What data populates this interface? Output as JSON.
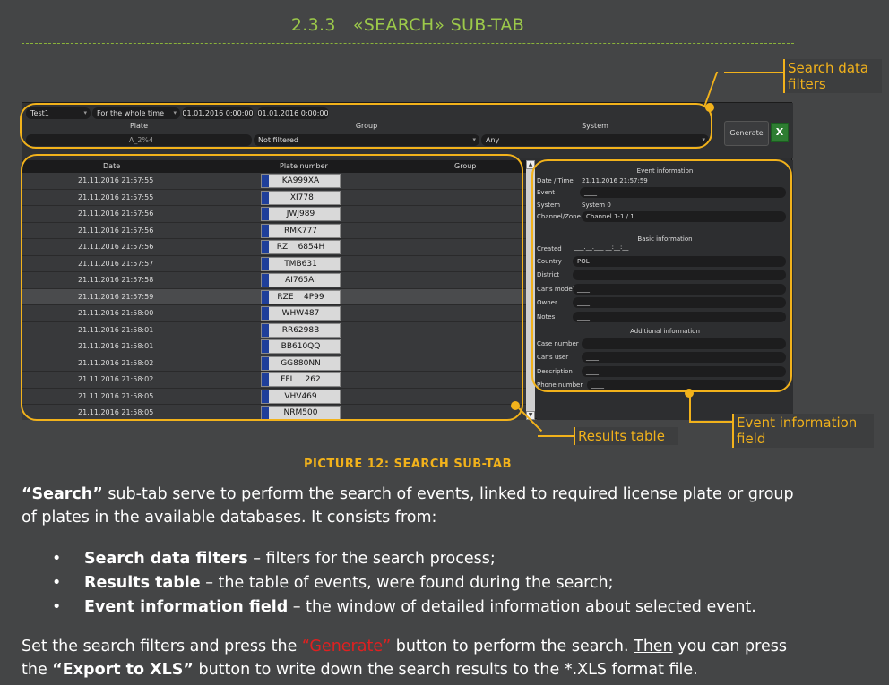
{
  "section": {
    "number": "2.3.3",
    "title": "«SEARCH» SUB-TAB"
  },
  "filters": {
    "source": "Test1",
    "period": "For the whole time",
    "date_from": "01.01.2016 0:00:00",
    "date_to": "01.01.2016 0:00:00",
    "plate_label": "Plate",
    "plate_value": "A_2%4",
    "group_label": "Group",
    "group_value": "Not filtered",
    "system_label": "System",
    "system_value": "Any",
    "generate_label": "Generate",
    "xls_icon": "X"
  },
  "table": {
    "columns": [
      "Date",
      "Plate number",
      "Group"
    ],
    "rows": [
      {
        "date": "21.11.2016 21:57:55",
        "plate": "KA999XA"
      },
      {
        "date": "21.11.2016 21:57:55",
        "plate": "IXI778"
      },
      {
        "date": "21.11.2016 21:57:56",
        "plate": "JWJ989"
      },
      {
        "date": "21.11.2016 21:57:56",
        "plate": "RMK777"
      },
      {
        "date": "21.11.2016 21:57:56",
        "plate": "RZ    6854H"
      },
      {
        "date": "21.11.2016 21:57:57",
        "plate": "TMB631"
      },
      {
        "date": "21.11.2016 21:57:58",
        "plate": "AI765AI"
      },
      {
        "date": "21.11.2016 21:57:59",
        "plate": "RZE    4P99"
      },
      {
        "date": "21.11.2016 21:58:00",
        "plate": "WHW487"
      },
      {
        "date": "21.11.2016 21:58:01",
        "plate": "RR6298B"
      },
      {
        "date": "21.11.2016 21:58:01",
        "plate": "BB610QQ"
      },
      {
        "date": "21.11.2016 21:58:02",
        "plate": "GG880NN"
      },
      {
        "date": "21.11.2016 21:58:02",
        "plate": "FFI     262"
      },
      {
        "date": "21.11.2016 21:58:05",
        "plate": "VHV469"
      },
      {
        "date": "21.11.2016 21:58:05",
        "plate": "NRM500"
      }
    ]
  },
  "event_info": {
    "header": "Event information",
    "datetime_label": "Date / Time",
    "datetime_value": "21.11.2016 21:57:59",
    "event_label": "Event",
    "event_value": "____",
    "system_label": "System",
    "system_value": "System 0",
    "channel_label": "Channel/Zone",
    "channel_value": "Channel 1-1 / 1",
    "basic_header": "Basic information",
    "created_label": "Created",
    "created_value": "___.__.___ __:__:__",
    "country_label": "Country",
    "country_value": "POL",
    "district_label": "District",
    "district_value": "____",
    "model_label": "Car's model",
    "model_value": "____",
    "owner_label": "Owner",
    "owner_value": "____",
    "notes_label": "Notes",
    "notes_value": "____",
    "additional_header": "Additional information",
    "case_label": "Case number",
    "case_value": "____",
    "caruser_label": "Car's user",
    "caruser_value": "____",
    "description_label": "Description",
    "description_value": "____",
    "phone_label": "Phone number",
    "phone_value": "____"
  },
  "callouts": {
    "filters": "Search data filters",
    "results": "Results table",
    "event": "Event information field"
  },
  "caption": "PICTURE 12: SEARCH SUB-TAB",
  "intro": {
    "bold": "“Search”",
    "rest": " sub-tab serve to perform the search of events, linked to required license plate or group of plates in the available databases. It consists from:"
  },
  "bullets": [
    {
      "term": "Search data filters",
      "desc": " – filters for the search process;"
    },
    {
      "term": "Results table",
      "desc": " – the table of events, were found during the search;"
    },
    {
      "term": "Event information field",
      "desc": " – the window of detailed information about selected event."
    }
  ],
  "closing": {
    "p1": "Set the search filters and press the ",
    "generate": "“Generate”",
    "p2": " button to perform the search. ",
    "then": "Then",
    "p3": " you can press the ",
    "export": "“Export to XLS”",
    "p4": " button to write down the search results to the *.XLS format file."
  },
  "colors": {
    "accent_green": "#9cc94a",
    "callout_yellow": "#f2b21b",
    "background": "#444546"
  }
}
